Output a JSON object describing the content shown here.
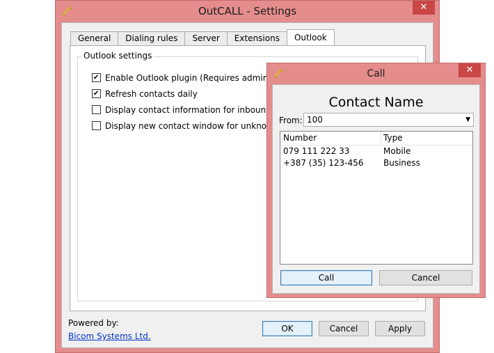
{
  "settings_window": {
    "title": "OutCALL  - Settings",
    "close_glyph": "✕",
    "tabs": [
      {
        "label": "General",
        "active": false
      },
      {
        "label": "Dialing rules",
        "active": false
      },
      {
        "label": "Server",
        "active": false
      },
      {
        "label": "Extensions",
        "active": false
      },
      {
        "label": "Outlook",
        "active": true
      }
    ],
    "group_label": "Outlook settings",
    "options": [
      {
        "label": "Enable Outlook plugin (Requires administrative privi",
        "checked": true
      },
      {
        "label": "Refresh contacts daily",
        "checked": true
      },
      {
        "label": "Display contact information for inbound calls",
        "checked": false
      },
      {
        "label": "Display new contact window for unknown callerID",
        "checked": false
      }
    ],
    "powered_by": "Powered by:",
    "vendor_link": "Bicom Systems Ltd.",
    "buttons": {
      "ok": "OK",
      "cancel": "Cancel",
      "apply": "Apply"
    }
  },
  "call_window": {
    "title": "Call",
    "close_glyph": "✕",
    "contact_name": "Contact Name",
    "from_label": "From:",
    "from_value": "100",
    "columns": {
      "number": "Number",
      "type": "Type"
    },
    "rows": [
      {
        "number": "079 111 222 33",
        "type": "Mobile"
      },
      {
        "number": "+387 (35) 123-456",
        "type": "Business"
      }
    ],
    "buttons": {
      "call": "Call",
      "cancel": "Cancel"
    }
  },
  "colors": {
    "frame": "#e58d8d",
    "close_button": "#c94747",
    "link": "#0033cc"
  },
  "icons": {
    "app": "handset-icon",
    "close": "close-icon",
    "dropdown": "chevron-down-icon"
  }
}
